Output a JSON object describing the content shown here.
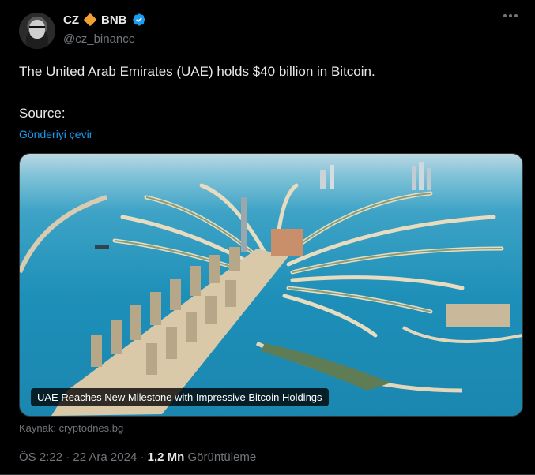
{
  "tweet": {
    "author_name": "CZ",
    "author_badge_text": "BNB",
    "handle": "@cz_binance",
    "text": "The United Arab Emirates (UAE) holds $40 billion in Bitcoin.",
    "source_label": "Source:",
    "translate_label": "Gönderiyi çevir",
    "card_caption": "UAE Reaches New Milestone with Impressive Bitcoin Holdings",
    "card_source": "Kaynak: cryptodnes.bg",
    "time": "ÖS 2:22",
    "separator": "·",
    "date": "22 Ara 2024",
    "views_count": "1,2 Mn",
    "views_label": "Görüntüleme"
  },
  "colors": {
    "background": "#000000",
    "text": "#e7e9ea",
    "muted": "#71767b",
    "link": "#1d9bf0",
    "verified": "#1d9bf0",
    "bnb_diamond": "#f3a033"
  },
  "icons": [
    "avatar",
    "bnb-diamond-icon",
    "verified-badge-icon",
    "more-options-icon"
  ]
}
